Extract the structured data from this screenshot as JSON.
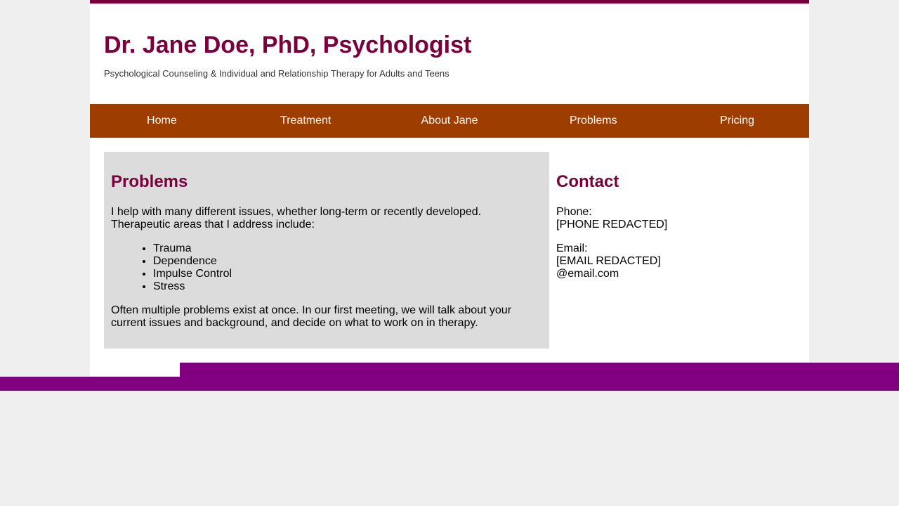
{
  "header": {
    "title": "Dr. Jane Doe, PhD, Psychologist",
    "tagline": "Psychological Counseling & Individual and Relationship Therapy for Adults and Teens"
  },
  "nav": {
    "items": [
      {
        "label": "Home"
      },
      {
        "label": "Treatment"
      },
      {
        "label": "About Jane"
      },
      {
        "label": "Problems"
      },
      {
        "label": "Pricing"
      }
    ]
  },
  "problems": {
    "heading": "Problems",
    "intro": "I help with many different issues, whether long-term or recently developed. Therapeutic areas that I address include:",
    "list": [
      "Trauma",
      "Dependence",
      "Impulse Control",
      "Stress"
    ],
    "outro": "Often multiple problems exist at once. In our first meeting, we will talk about your current issues and background, and decide on what to work on in therapy."
  },
  "contact": {
    "heading": "Contact",
    "phone_label": "Phone:",
    "phone_value": "[PHONE REDACTED]",
    "email_label": "Email:",
    "email_value_line1": "[EMAIL REDACTED]",
    "email_value_line2": "@email.com"
  },
  "colors": {
    "accent": "#7a003c",
    "nav_background": "#9e3d00",
    "footer": "#800080",
    "panel_background": "#dcdcdc",
    "page_background": "#efefef"
  }
}
